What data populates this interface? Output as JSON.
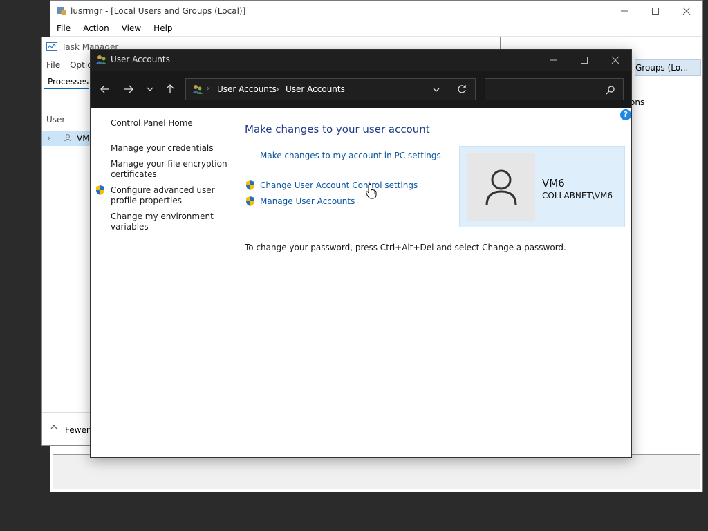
{
  "lusrmgr": {
    "title": "lusrmgr - [Local Users and Groups (Local)]",
    "menu": [
      "File",
      "Action",
      "View",
      "Help"
    ],
    "right_pane_title": "Groups (Lo...",
    "right_pane_sub": "ons"
  },
  "task_manager": {
    "title": "Task Manager",
    "menu": [
      "File",
      "Optio"
    ],
    "tab": "Processes",
    "column_header": "User",
    "row_label": "VM",
    "fewer_details": "Fewer"
  },
  "user_accounts": {
    "title": "User Accounts",
    "breadcrumb": [
      "User Accounts",
      "User Accounts"
    ],
    "breadcrumb_overflow": "«",
    "search_placeholder": "",
    "left_links": {
      "home": "Control Panel Home",
      "credentials": "Manage your credentials",
      "encryption_line1": "Manage your file encryption",
      "encryption_line2": "certificates",
      "profile_line1": "Configure advanced user",
      "profile_line2": "profile properties",
      "env_line1": "Change my environment",
      "env_line2": "variables"
    },
    "heading": "Make changes to your user account",
    "links": {
      "pc_settings": "Make changes to my account in PC settings",
      "uac": "Change User Account Control settings",
      "manage": "Manage User Accounts"
    },
    "info": "To change your password, press Ctrl+Alt+Del and select Change a password.",
    "user": {
      "name": "VM6",
      "domain": "COLLABNET\\VM6"
    },
    "help_icon": "?"
  },
  "colors": {
    "accent": "#0b57a4",
    "heading": "#1e3a8a",
    "card_bg": "#deeefa",
    "titlebar_dark": "#1f1f1f"
  }
}
